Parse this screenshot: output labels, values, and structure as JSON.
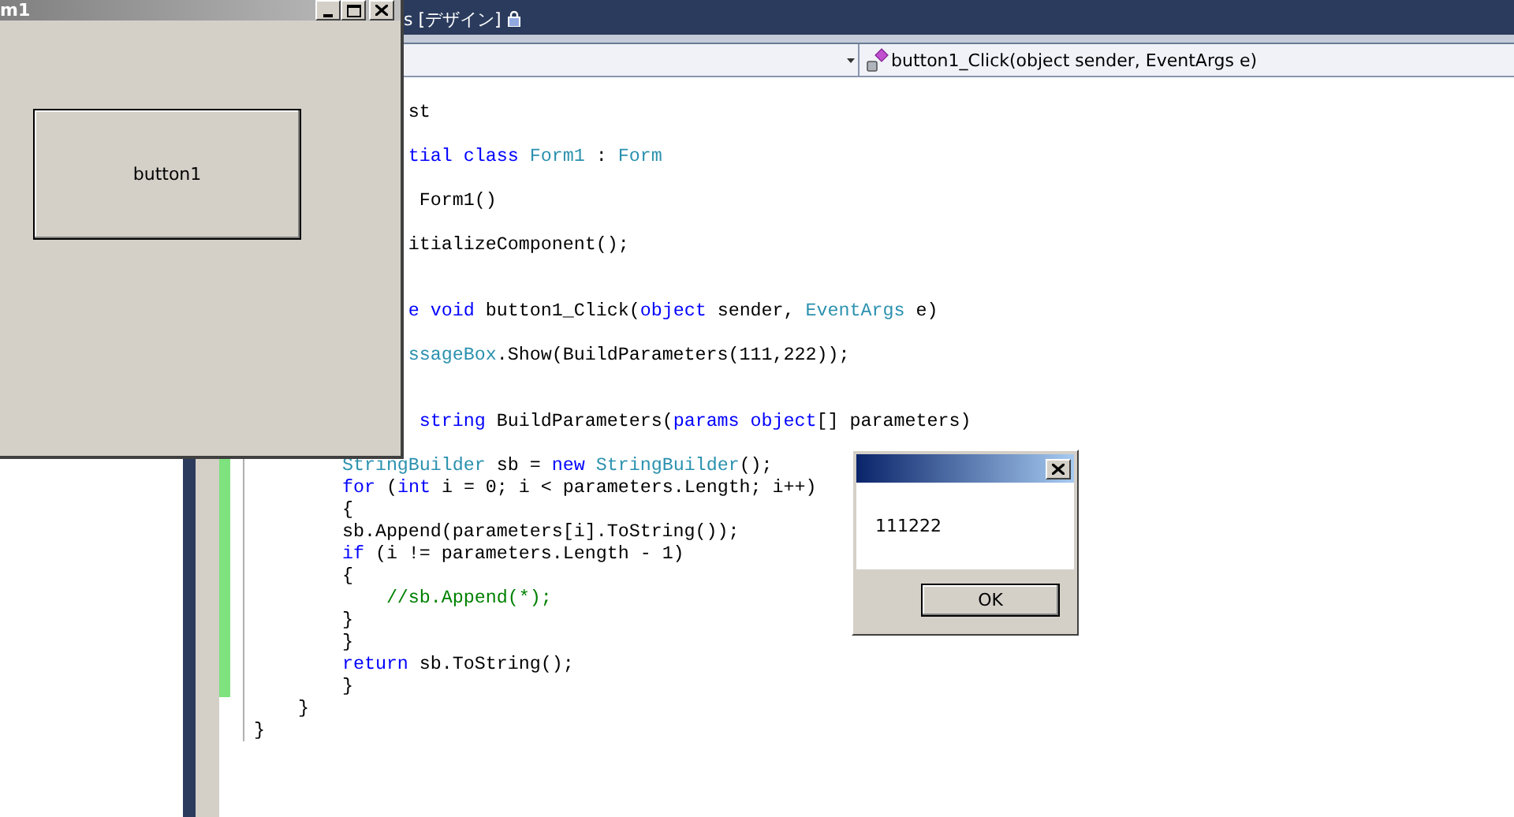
{
  "ide": {
    "tab": {
      "title": "s [デザイン]",
      "locked": true
    },
    "member_dropdown": {
      "value": "button1_Click(object sender, EventArgs e)"
    },
    "code_lines": [
      {
        "kind": "code",
        "tokens": [
          {
            "kind": "plain",
            "text": "              st"
          }
        ]
      },
      {
        "kind": "blank"
      },
      {
        "kind": "code",
        "tokens": [
          {
            "kind": "keyword",
            "text": "              tial class "
          },
          {
            "kind": "type",
            "text": "Form1"
          },
          {
            "kind": "plain",
            "text": " : "
          },
          {
            "kind": "type",
            "text": "Form"
          }
        ]
      },
      {
        "kind": "blank"
      },
      {
        "kind": "code",
        "tokens": [
          {
            "kind": "plain",
            "text": "               Form1()"
          }
        ]
      },
      {
        "kind": "blank"
      },
      {
        "kind": "code",
        "tokens": [
          {
            "kind": "plain",
            "text": "              itializeComponent();"
          }
        ]
      },
      {
        "kind": "blank"
      },
      {
        "kind": "blank"
      },
      {
        "kind": "code",
        "tokens": [
          {
            "kind": "keyword",
            "text": "              e void"
          },
          {
            "kind": "plain",
            "text": " button1_Click("
          },
          {
            "kind": "keyword",
            "text": "object"
          },
          {
            "kind": "plain",
            "text": " sender, "
          },
          {
            "kind": "type",
            "text": "EventArgs"
          },
          {
            "kind": "plain",
            "text": " e)"
          }
        ]
      },
      {
        "kind": "blank"
      },
      {
        "kind": "code",
        "tokens": [
          {
            "kind": "type",
            "text": "              ssageBox"
          },
          {
            "kind": "plain",
            "text": ".Show(BuildParameters(111,222));"
          }
        ]
      },
      {
        "kind": "blank"
      },
      {
        "kind": "blank"
      },
      {
        "kind": "code",
        "tokens": [
          {
            "kind": "keyword",
            "text": "               string"
          },
          {
            "kind": "plain",
            "text": " BuildParameters("
          },
          {
            "kind": "keyword",
            "text": "params object"
          },
          {
            "kind": "plain",
            "text": "[] parameters)"
          }
        ]
      },
      {
        "kind": "blank"
      },
      {
        "kind": "code",
        "changed": true,
        "tokens": [
          {
            "kind": "type",
            "text": "        StringBuilder"
          },
          {
            "kind": "plain",
            "text": " sb = "
          },
          {
            "kind": "keyword",
            "text": "new "
          },
          {
            "kind": "type",
            "text": "StringBuilder"
          },
          {
            "kind": "plain",
            "text": "();"
          }
        ]
      },
      {
        "kind": "code",
        "changed": true,
        "tokens": [
          {
            "kind": "keyword",
            "text": "        for"
          },
          {
            "kind": "plain",
            "text": " ("
          },
          {
            "kind": "keyword",
            "text": "int"
          },
          {
            "kind": "plain",
            "text": " i = 0; i < parameters.Length; i++)"
          }
        ]
      },
      {
        "kind": "code",
        "changed": true,
        "tokens": [
          {
            "kind": "plain",
            "text": "        {"
          }
        ]
      },
      {
        "kind": "code",
        "changed": true,
        "tokens": [
          {
            "kind": "plain",
            "text": "        sb.Append(parameters[i].ToString());"
          }
        ]
      },
      {
        "kind": "code",
        "changed": true,
        "tokens": [
          {
            "kind": "keyword",
            "text": "        if"
          },
          {
            "kind": "plain",
            "text": " (i != parameters.Length - 1)"
          }
        ]
      },
      {
        "kind": "code",
        "changed": true,
        "tokens": [
          {
            "kind": "plain",
            "text": "        {"
          }
        ]
      },
      {
        "kind": "code",
        "changed": true,
        "tokens": [
          {
            "kind": "comment",
            "text": "            //sb.Append(*);"
          }
        ]
      },
      {
        "kind": "code",
        "changed": true,
        "tokens": [
          {
            "kind": "plain",
            "text": "        }"
          }
        ]
      },
      {
        "kind": "code",
        "changed": true,
        "tokens": [
          {
            "kind": "plain",
            "text": "        }"
          }
        ]
      },
      {
        "kind": "code",
        "changed": true,
        "tokens": [
          {
            "kind": "keyword",
            "text": "        return"
          },
          {
            "kind": "plain",
            "text": " sb.ToString();"
          }
        ]
      },
      {
        "kind": "code",
        "changed": true,
        "tokens": [
          {
            "kind": "plain",
            "text": "        }"
          }
        ]
      },
      {
        "kind": "code",
        "changed": false,
        "tokens": [
          {
            "kind": "plain",
            "text": "    }"
          }
        ]
      },
      {
        "kind": "code",
        "changed": false,
        "tokens": [
          {
            "kind": "plain",
            "text": "}"
          }
        ]
      }
    ]
  },
  "form_window": {
    "title": "m1",
    "button": "button1"
  },
  "message_box": {
    "message": "111222",
    "ok_button": "OK"
  }
}
